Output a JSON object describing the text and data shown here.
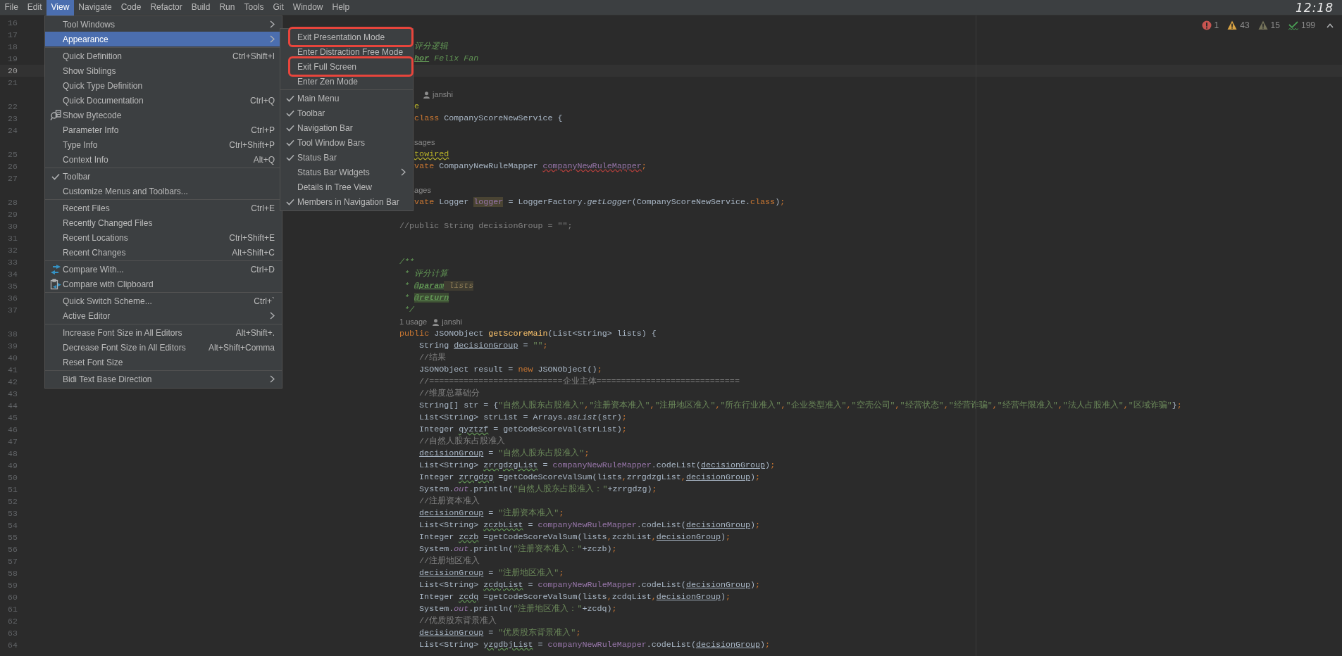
{
  "menu_bar": {
    "items": [
      {
        "label": "File",
        "selected": false
      },
      {
        "label": "Edit",
        "selected": false
      },
      {
        "label": "View",
        "selected": true
      },
      {
        "label": "Navigate",
        "selected": false
      },
      {
        "label": "Code",
        "selected": false
      },
      {
        "label": "Refactor",
        "selected": false
      },
      {
        "label": "Build",
        "selected": false
      },
      {
        "label": "Run",
        "selected": false
      },
      {
        "label": "Tools",
        "selected": false
      },
      {
        "label": "Git",
        "selected": false
      },
      {
        "label": "Window",
        "selected": false
      },
      {
        "label": "Help",
        "selected": false
      }
    ],
    "clock": "12:18"
  },
  "inspections": [
    {
      "kind": "error",
      "count": "1"
    },
    {
      "kind": "warning",
      "count": "43"
    },
    {
      "kind": "weak",
      "count": "15"
    },
    {
      "kind": "typo",
      "count": "199"
    }
  ],
  "editor": {
    "rows": [
      {
        "kind": "line",
        "number": "16",
        "current": false,
        "indent": "",
        "tokens": []
      },
      {
        "kind": "line",
        "number": "17",
        "current": false,
        "indent": "",
        "tokens": []
      },
      {
        "kind": "line",
        "number": "18",
        "current": false,
        "indent": "       ",
        "tokens": [
          {
            "text": "评分逻辑",
            "kind": "doc"
          }
        ]
      },
      {
        "kind": "line",
        "number": "19",
        "current": false,
        "indent": "       ",
        "tokens": [
          {
            "text": "hor",
            "kind": "doctag"
          },
          {
            "text": " Felix Fan",
            "kind": "doc"
          }
        ]
      },
      {
        "kind": "line",
        "number": "20",
        "current": true,
        "indent": "",
        "tokens": []
      },
      {
        "kind": "line",
        "number": "21",
        "current": false,
        "indent": "",
        "tokens": []
      },
      {
        "kind": "inlay",
        "indent": "        ",
        "author": "janshi"
      },
      {
        "kind": "line",
        "number": "22",
        "current": false,
        "indent": "       ",
        "tokens": [
          {
            "text": "e",
            "kind": "annotation"
          }
        ]
      },
      {
        "kind": "line",
        "number": "23",
        "current": false,
        "indent": "       ",
        "tokens": [
          {
            "text": "class",
            "kind": "keyword"
          },
          {
            "text": " CompanyScoreNewService {",
            "kind": "plain"
          }
        ]
      },
      {
        "kind": "line",
        "number": "24",
        "current": false,
        "indent": "",
        "tokens": []
      },
      {
        "kind": "inlay",
        "indent": "       ",
        "usage": "sages"
      },
      {
        "kind": "line",
        "number": "25",
        "current": false,
        "indent": "       ",
        "tokens": [
          {
            "text": "towired",
            "kind": "annotationwarn"
          }
        ]
      },
      {
        "kind": "line",
        "number": "26",
        "current": false,
        "indent": "       ",
        "tokens": [
          {
            "text": "vate",
            "kind": "keyword"
          },
          {
            "text": " CompanyNewRuleMapper ",
            "kind": "plain"
          },
          {
            "text": "companyNewRuleMapper",
            "kind": "fielderror"
          },
          {
            "text": ";",
            "kind": "keyword"
          }
        ]
      },
      {
        "kind": "line",
        "number": "27",
        "current": false,
        "indent": "",
        "tokens": []
      },
      {
        "kind": "inlay",
        "indent": "       ",
        "usage": "ages"
      },
      {
        "kind": "line",
        "number": "28",
        "current": false,
        "indent": "       ",
        "tokens": [
          {
            "text": "vate",
            "kind": "keyword"
          },
          {
            "text": " Logger ",
            "kind": "plain"
          },
          {
            "text": "logger",
            "kind": "fieldmarked"
          },
          {
            "text": " = LoggerFactory.",
            "kind": "plain"
          },
          {
            "text": "getLogger",
            "kind": "static"
          },
          {
            "text": "(CompanyScoreNewService.",
            "kind": "plain"
          },
          {
            "text": "class",
            "kind": "keyword"
          },
          {
            "text": ")",
            "kind": "plain"
          },
          {
            "text": ";",
            "kind": "keyword"
          }
        ]
      },
      {
        "kind": "line",
        "number": "29",
        "current": false,
        "indent": "",
        "tokens": []
      },
      {
        "kind": "line",
        "number": "30",
        "current": false,
        "indent": "    ",
        "tokens": [
          {
            "text": "//public String decisionGroup = \"\";",
            "kind": "comment"
          }
        ]
      },
      {
        "kind": "line",
        "number": "31",
        "current": false,
        "indent": "",
        "tokens": []
      },
      {
        "kind": "line",
        "number": "32",
        "current": false,
        "indent": "",
        "tokens": []
      },
      {
        "kind": "line",
        "number": "33",
        "current": false,
        "indent": "    ",
        "tokens": [
          {
            "text": "/**",
            "kind": "doc"
          }
        ]
      },
      {
        "kind": "line",
        "number": "34",
        "current": false,
        "indent": "    ",
        "tokens": [
          {
            "text": " * 评分计算",
            "kind": "doc"
          }
        ]
      },
      {
        "kind": "line",
        "number": "35",
        "current": false,
        "indent": "    ",
        "tokens": [
          {
            "text": " * ",
            "kind": "doc"
          },
          {
            "text": "@param",
            "kind": "doctag"
          },
          {
            "text": " lists",
            "kind": "paramref"
          }
        ]
      },
      {
        "kind": "line",
        "number": "36",
        "current": false,
        "indent": "    ",
        "tokens": [
          {
            "text": " * ",
            "kind": "doc"
          },
          {
            "text": "@return",
            "kind": "doctagmarked"
          }
        ]
      },
      {
        "kind": "line",
        "number": "37",
        "current": false,
        "indent": "    ",
        "tokens": [
          {
            "text": " */",
            "kind": "doc"
          }
        ]
      },
      {
        "kind": "inlay",
        "indent": "    ",
        "usage": "1 usage",
        "author": "janshi"
      },
      {
        "kind": "line",
        "number": "38",
        "current": false,
        "indent": "    ",
        "tokens": [
          {
            "text": "public",
            "kind": "keyword"
          },
          {
            "text": " JSONObject ",
            "kind": "plain"
          },
          {
            "text": "getScoreMain",
            "kind": "method"
          },
          {
            "text": "(List<String> lists) {",
            "kind": "plain"
          }
        ]
      },
      {
        "kind": "line",
        "number": "39",
        "current": false,
        "indent": "        ",
        "tokens": [
          {
            "text": "String ",
            "kind": "plain"
          },
          {
            "text": "decisionGroup",
            "kind": "reassigned"
          },
          {
            "text": " = ",
            "kind": "plain"
          },
          {
            "text": "\"\"",
            "kind": "string"
          },
          {
            "text": ";",
            "kind": "keyword"
          }
        ]
      },
      {
        "kind": "line",
        "number": "40",
        "current": false,
        "indent": "        ",
        "tokens": [
          {
            "text": "//结果",
            "kind": "comment"
          }
        ]
      },
      {
        "kind": "line",
        "number": "41",
        "current": false,
        "indent": "        ",
        "tokens": [
          {
            "text": "JSONObject result = ",
            "kind": "plain"
          },
          {
            "text": "new",
            "kind": "keyword"
          },
          {
            "text": " JSONObject()",
            "kind": "plain"
          },
          {
            "text": ";",
            "kind": "keyword"
          }
        ]
      },
      {
        "kind": "line",
        "number": "42",
        "current": false,
        "indent": "        ",
        "tokens": [
          {
            "text": "//===========================企业主体=============================",
            "kind": "comment"
          }
        ]
      },
      {
        "kind": "line",
        "number": "43",
        "current": false,
        "indent": "        ",
        "tokens": [
          {
            "text": "//维度总基础分",
            "kind": "comment"
          }
        ]
      },
      {
        "kind": "line",
        "number": "44",
        "current": false,
        "indent": "        ",
        "tokens": [
          {
            "text": "String[] str = {",
            "kind": "plain"
          },
          {
            "text": "\"自然人股东占股准入\"",
            "kind": "string"
          },
          {
            "text": ",",
            "kind": "keyword"
          },
          {
            "text": "\"注册资本准入\"",
            "kind": "string"
          },
          {
            "text": ",",
            "kind": "keyword"
          },
          {
            "text": "\"注册地区准入\"",
            "kind": "string"
          },
          {
            "text": ",",
            "kind": "keyword"
          },
          {
            "text": "\"所在行业准入\"",
            "kind": "string"
          },
          {
            "text": ",",
            "kind": "keyword"
          },
          {
            "text": "\"企业类型准入\"",
            "kind": "string"
          },
          {
            "text": ",",
            "kind": "keyword"
          },
          {
            "text": "\"空壳公司\"",
            "kind": "string"
          },
          {
            "text": ",",
            "kind": "keyword"
          },
          {
            "text": "\"经营状态\"",
            "kind": "string"
          },
          {
            "text": ",",
            "kind": "keyword"
          },
          {
            "text": "\"经营诈骗\"",
            "kind": "string"
          },
          {
            "text": ",",
            "kind": "keyword"
          },
          {
            "text": "\"经营年限准入\"",
            "kind": "string"
          },
          {
            "text": ",",
            "kind": "keyword"
          },
          {
            "text": "\"法人占股准入\"",
            "kind": "string"
          },
          {
            "text": ",",
            "kind": "keyword"
          },
          {
            "text": "\"区域诈骗\"",
            "kind": "string"
          },
          {
            "text": "}",
            "kind": "plain"
          },
          {
            "text": ";",
            "kind": "keyword"
          }
        ]
      },
      {
        "kind": "line",
        "number": "45",
        "current": false,
        "indent": "        ",
        "tokens": [
          {
            "text": "List<String> strList = Arrays.",
            "kind": "plain"
          },
          {
            "text": "asList",
            "kind": "static"
          },
          {
            "text": "(str)",
            "kind": "plain"
          },
          {
            "text": ";",
            "kind": "keyword"
          }
        ]
      },
      {
        "kind": "line",
        "number": "46",
        "current": false,
        "indent": "        ",
        "tokens": [
          {
            "text": "Integer ",
            "kind": "plain"
          },
          {
            "text": "qyztzf",
            "kind": "typo"
          },
          {
            "text": " = getCodeScoreVal(strList)",
            "kind": "plain"
          },
          {
            "text": ";",
            "kind": "keyword"
          }
        ]
      },
      {
        "kind": "line",
        "number": "47",
        "current": false,
        "indent": "        ",
        "tokens": [
          {
            "text": "//自然人股东占股准入",
            "kind": "comment"
          }
        ]
      },
      {
        "kind": "line",
        "number": "48",
        "current": false,
        "indent": "        ",
        "tokens": [
          {
            "text": "decisionGroup",
            "kind": "reassigned"
          },
          {
            "text": " = ",
            "kind": "plain"
          },
          {
            "text": "\"自然人股东占股准入\"",
            "kind": "string"
          },
          {
            "text": ";",
            "kind": "keyword"
          }
        ]
      },
      {
        "kind": "line",
        "number": "49",
        "current": false,
        "indent": "        ",
        "tokens": [
          {
            "text": "List<String> ",
            "kind": "plain"
          },
          {
            "text": "zrrgdzgList",
            "kind": "typo"
          },
          {
            "text": " = ",
            "kind": "plain"
          },
          {
            "text": "companyNewRuleMapper",
            "kind": "field"
          },
          {
            "text": ".codeList(",
            "kind": "plain"
          },
          {
            "text": "decisionGroup",
            "kind": "reassigned"
          },
          {
            "text": ")",
            "kind": "plain"
          },
          {
            "text": ";",
            "kind": "keyword"
          }
        ]
      },
      {
        "kind": "line",
        "number": "50",
        "current": false,
        "indent": "        ",
        "tokens": [
          {
            "text": "Integer ",
            "kind": "plain"
          },
          {
            "text": "zrrgdzg",
            "kind": "typo"
          },
          {
            "text": " =getCodeScoreValSum(lists",
            "kind": "plain"
          },
          {
            "text": ",",
            "kind": "keyword"
          },
          {
            "text": "zrrgdzgList",
            "kind": "plain"
          },
          {
            "text": ",",
            "kind": "keyword"
          },
          {
            "text": "decisionGroup",
            "kind": "reassigned"
          },
          {
            "text": ")",
            "kind": "plain"
          },
          {
            "text": ";",
            "kind": "keyword"
          }
        ]
      },
      {
        "kind": "line",
        "number": "51",
        "current": false,
        "indent": "        ",
        "tokens": [
          {
            "text": "System.",
            "kind": "plain"
          },
          {
            "text": "out",
            "kind": "staticfield"
          },
          {
            "text": ".println(",
            "kind": "plain"
          },
          {
            "text": "\"自然人股东占股准入：\"",
            "kind": "string"
          },
          {
            "text": "+zrrgdzg)",
            "kind": "plain"
          },
          {
            "text": ";",
            "kind": "keyword"
          }
        ]
      },
      {
        "kind": "line",
        "number": "52",
        "current": false,
        "indent": "        ",
        "tokens": [
          {
            "text": "//注册资本准入",
            "kind": "comment"
          }
        ]
      },
      {
        "kind": "line",
        "number": "53",
        "current": false,
        "indent": "        ",
        "tokens": [
          {
            "text": "decisionGroup",
            "kind": "reassigned"
          },
          {
            "text": " = ",
            "kind": "plain"
          },
          {
            "text": "\"注册资本准入\"",
            "kind": "string"
          },
          {
            "text": ";",
            "kind": "keyword"
          }
        ]
      },
      {
        "kind": "line",
        "number": "54",
        "current": false,
        "indent": "        ",
        "tokens": [
          {
            "text": "List<String> ",
            "kind": "plain"
          },
          {
            "text": "zczbList",
            "kind": "typo"
          },
          {
            "text": " = ",
            "kind": "plain"
          },
          {
            "text": "companyNewRuleMapper",
            "kind": "field"
          },
          {
            "text": ".codeList(",
            "kind": "plain"
          },
          {
            "text": "decisionGroup",
            "kind": "reassigned"
          },
          {
            "text": ")",
            "kind": "plain"
          },
          {
            "text": ";",
            "kind": "keyword"
          }
        ]
      },
      {
        "kind": "line",
        "number": "55",
        "current": false,
        "indent": "        ",
        "tokens": [
          {
            "text": "Integer ",
            "kind": "plain"
          },
          {
            "text": "zczb",
            "kind": "typo"
          },
          {
            "text": " =getCodeScoreValSum(lists",
            "kind": "plain"
          },
          {
            "text": ",",
            "kind": "keyword"
          },
          {
            "text": "zczbList",
            "kind": "plain"
          },
          {
            "text": ",",
            "kind": "keyword"
          },
          {
            "text": "decisionGroup",
            "kind": "reassigned"
          },
          {
            "text": ")",
            "kind": "plain"
          },
          {
            "text": ";",
            "kind": "keyword"
          }
        ]
      },
      {
        "kind": "line",
        "number": "56",
        "current": false,
        "indent": "        ",
        "tokens": [
          {
            "text": "System.",
            "kind": "plain"
          },
          {
            "text": "out",
            "kind": "staticfield"
          },
          {
            "text": ".println(",
            "kind": "plain"
          },
          {
            "text": "\"注册资本准入：\"",
            "kind": "string"
          },
          {
            "text": "+zczb)",
            "kind": "plain"
          },
          {
            "text": ";",
            "kind": "keyword"
          }
        ]
      },
      {
        "kind": "line",
        "number": "57",
        "current": false,
        "indent": "        ",
        "tokens": [
          {
            "text": "//注册地区准入",
            "kind": "comment"
          }
        ]
      },
      {
        "kind": "line",
        "number": "58",
        "current": false,
        "indent": "        ",
        "tokens": [
          {
            "text": "decisionGroup",
            "kind": "reassigned"
          },
          {
            "text": " = ",
            "kind": "plain"
          },
          {
            "text": "\"注册地区准入\"",
            "kind": "string"
          },
          {
            "text": ";",
            "kind": "keyword"
          }
        ]
      },
      {
        "kind": "line",
        "number": "59",
        "current": false,
        "indent": "        ",
        "tokens": [
          {
            "text": "List<String> ",
            "kind": "plain"
          },
          {
            "text": "zcdqList",
            "kind": "typo"
          },
          {
            "text": " = ",
            "kind": "plain"
          },
          {
            "text": "companyNewRuleMapper",
            "kind": "field"
          },
          {
            "text": ".codeList(",
            "kind": "plain"
          },
          {
            "text": "decisionGroup",
            "kind": "reassigned"
          },
          {
            "text": ")",
            "kind": "plain"
          },
          {
            "text": ";",
            "kind": "keyword"
          }
        ]
      },
      {
        "kind": "line",
        "number": "60",
        "current": false,
        "indent": "        ",
        "tokens": [
          {
            "text": "Integer ",
            "kind": "plain"
          },
          {
            "text": "zcdq",
            "kind": "typo"
          },
          {
            "text": " =getCodeScoreValSum(lists",
            "kind": "plain"
          },
          {
            "text": ",",
            "kind": "keyword"
          },
          {
            "text": "zcdqList",
            "kind": "plain"
          },
          {
            "text": ",",
            "kind": "keyword"
          },
          {
            "text": "decisionGroup",
            "kind": "reassigned"
          },
          {
            "text": ")",
            "kind": "plain"
          },
          {
            "text": ";",
            "kind": "keyword"
          }
        ]
      },
      {
        "kind": "line",
        "number": "61",
        "current": false,
        "indent": "        ",
        "tokens": [
          {
            "text": "System.",
            "kind": "plain"
          },
          {
            "text": "out",
            "kind": "staticfield"
          },
          {
            "text": ".println(",
            "kind": "plain"
          },
          {
            "text": "\"注册地区准入：\"",
            "kind": "string"
          },
          {
            "text": "+zcdq)",
            "kind": "plain"
          },
          {
            "text": ";",
            "kind": "keyword"
          }
        ]
      },
      {
        "kind": "line",
        "number": "62",
        "current": false,
        "indent": "        ",
        "tokens": [
          {
            "text": "//优质股东背景准入",
            "kind": "comment"
          }
        ]
      },
      {
        "kind": "line",
        "number": "63",
        "current": false,
        "indent": "        ",
        "tokens": [
          {
            "text": "decisionGroup",
            "kind": "reassigned"
          },
          {
            "text": " = ",
            "kind": "plain"
          },
          {
            "text": "\"优质股东背景准入\"",
            "kind": "string"
          },
          {
            "text": ";",
            "kind": "keyword"
          }
        ]
      },
      {
        "kind": "line",
        "number": "64",
        "current": false,
        "indent": "        ",
        "tokens": [
          {
            "text": "List<String> ",
            "kind": "plain"
          },
          {
            "text": "yzgdbjList",
            "kind": "typo"
          },
          {
            "text": " = ",
            "kind": "plain"
          },
          {
            "text": "companyNewRuleMapper",
            "kind": "field"
          },
          {
            "text": ".codeList(",
            "kind": "plain"
          },
          {
            "text": "decisionGroup",
            "kind": "reassigned"
          },
          {
            "text": ")",
            "kind": "plain"
          },
          {
            "text": ";",
            "kind": "keyword"
          }
        ]
      }
    ]
  },
  "view_menu": {
    "items": [
      {
        "kind": "item",
        "label": "Tool Windows",
        "submenu": true,
        "checked": false,
        "selected": false
      },
      {
        "kind": "item",
        "label": "Appearance",
        "submenu": true,
        "checked": false,
        "selected": true
      },
      {
        "kind": "separator"
      },
      {
        "kind": "item",
        "label": "Quick Definition",
        "shortcut": "Ctrl+Shift+I",
        "submenu": false,
        "checked": false,
        "selected": false
      },
      {
        "kind": "item",
        "label": "Show Siblings",
        "submenu": false,
        "checked": false,
        "selected": false
      },
      {
        "kind": "item",
        "label": "Quick Type Definition",
        "submenu": false,
        "checked": false,
        "selected": false
      },
      {
        "kind": "item",
        "label": "Quick Documentation",
        "shortcut": "Ctrl+Q",
        "submenu": false,
        "checked": false,
        "selected": false
      },
      {
        "kind": "bytecode",
        "label": "Show Bytecode",
        "submenu": false,
        "checked": false,
        "selected": false
      },
      {
        "kind": "item",
        "label": "Parameter Info",
        "shortcut": "Ctrl+P",
        "submenu": false,
        "checked": false,
        "selected": false
      },
      {
        "kind": "item",
        "label": "Type Info",
        "shortcut": "Ctrl+Shift+P",
        "submenu": false,
        "checked": false,
        "selected": false
      },
      {
        "kind": "item",
        "label": "Context Info",
        "shortcut": "Alt+Q",
        "submenu": false,
        "checked": false,
        "selected": false
      },
      {
        "kind": "separator"
      },
      {
        "kind": "item",
        "label": "Toolbar",
        "submenu": false,
        "checked": true,
        "selected": false
      },
      {
        "kind": "item",
        "label": "Customize Menus and Toolbars...",
        "submenu": false,
        "checked": false,
        "selected": false
      },
      {
        "kind": "separator"
      },
      {
        "kind": "item",
        "label": "Recent Files",
        "shortcut": "Ctrl+E",
        "submenu": false,
        "checked": false,
        "selected": false
      },
      {
        "kind": "item",
        "label": "Recently Changed Files",
        "submenu": false,
        "checked": false,
        "selected": false
      },
      {
        "kind": "item",
        "label": "Recent Locations",
        "shortcut": "Ctrl+Shift+E",
        "submenu": false,
        "checked": false,
        "selected": false
      },
      {
        "kind": "item",
        "label": "Recent Changes",
        "shortcut": "Alt+Shift+C",
        "submenu": false,
        "checked": false,
        "selected": false
      },
      {
        "kind": "separator"
      },
      {
        "kind": "compare",
        "label": "Compare With...",
        "shortcut": "Ctrl+D",
        "submenu": false,
        "checked": false,
        "selected": false
      },
      {
        "kind": "clipboard",
        "label": "Compare with Clipboard",
        "submenu": false,
        "checked": false,
        "selected": false
      },
      {
        "kind": "separator"
      },
      {
        "kind": "item",
        "label": "Quick Switch Scheme...",
        "shortcut": "Ctrl+`",
        "submenu": false,
        "checked": false,
        "selected": false
      },
      {
        "kind": "item",
        "label": "Active Editor",
        "submenu": true,
        "checked": false,
        "selected": false
      },
      {
        "kind": "separator"
      },
      {
        "kind": "item",
        "label": "Increase Font Size in All Editors",
        "shortcut": "Alt+Shift+.",
        "submenu": false,
        "checked": false,
        "selected": false
      },
      {
        "kind": "item",
        "label": "Decrease Font Size in All Editors",
        "shortcut": "Alt+Shift+Comma",
        "submenu": false,
        "checked": false,
        "selected": false
      },
      {
        "kind": "item",
        "label": "Reset Font Size",
        "submenu": false,
        "checked": false,
        "selected": false
      },
      {
        "kind": "separator"
      },
      {
        "kind": "item",
        "label": "Bidi Text Base Direction",
        "submenu": true,
        "checked": false,
        "selected": false
      }
    ]
  },
  "appearance_menu": {
    "items": [
      {
        "kind": "item",
        "label": "Exit Presentation Mode",
        "marked": true,
        "submenu": false,
        "checked": false,
        "selected": false
      },
      {
        "kind": "item",
        "label": "Enter Distraction Free Mode",
        "marked": false,
        "submenu": false,
        "checked": false,
        "selected": false
      },
      {
        "kind": "item",
        "label": "Exit Full Screen",
        "marked": true,
        "submenu": false,
        "checked": false,
        "selected": false
      },
      {
        "kind": "item",
        "label": "Enter Zen Mode",
        "marked": false,
        "submenu": false,
        "checked": false,
        "selected": false
      },
      {
        "kind": "separator"
      },
      {
        "kind": "item",
        "label": "Main Menu",
        "marked": false,
        "submenu": false,
        "checked": true,
        "selected": false
      },
      {
        "kind": "item",
        "label": "Toolbar",
        "marked": false,
        "submenu": false,
        "checked": true,
        "selected": false
      },
      {
        "kind": "item",
        "label": "Navigation Bar",
        "marked": false,
        "submenu": false,
        "checked": true,
        "selected": false
      },
      {
        "kind": "item",
        "label": "Tool Window Bars",
        "marked": false,
        "submenu": false,
        "checked": true,
        "selected": false
      },
      {
        "kind": "item",
        "label": "Status Bar",
        "marked": false,
        "submenu": false,
        "checked": true,
        "selected": false
      },
      {
        "kind": "item",
        "label": "Status Bar Widgets",
        "marked": false,
        "submenu": true,
        "checked": false,
        "selected": false
      },
      {
        "kind": "item",
        "label": "Details in Tree View",
        "marked": false,
        "submenu": false,
        "checked": false,
        "selected": false
      },
      {
        "kind": "item",
        "label": "Members in Navigation Bar",
        "marked": false,
        "submenu": false,
        "checked": true,
        "selected": false
      }
    ]
  }
}
